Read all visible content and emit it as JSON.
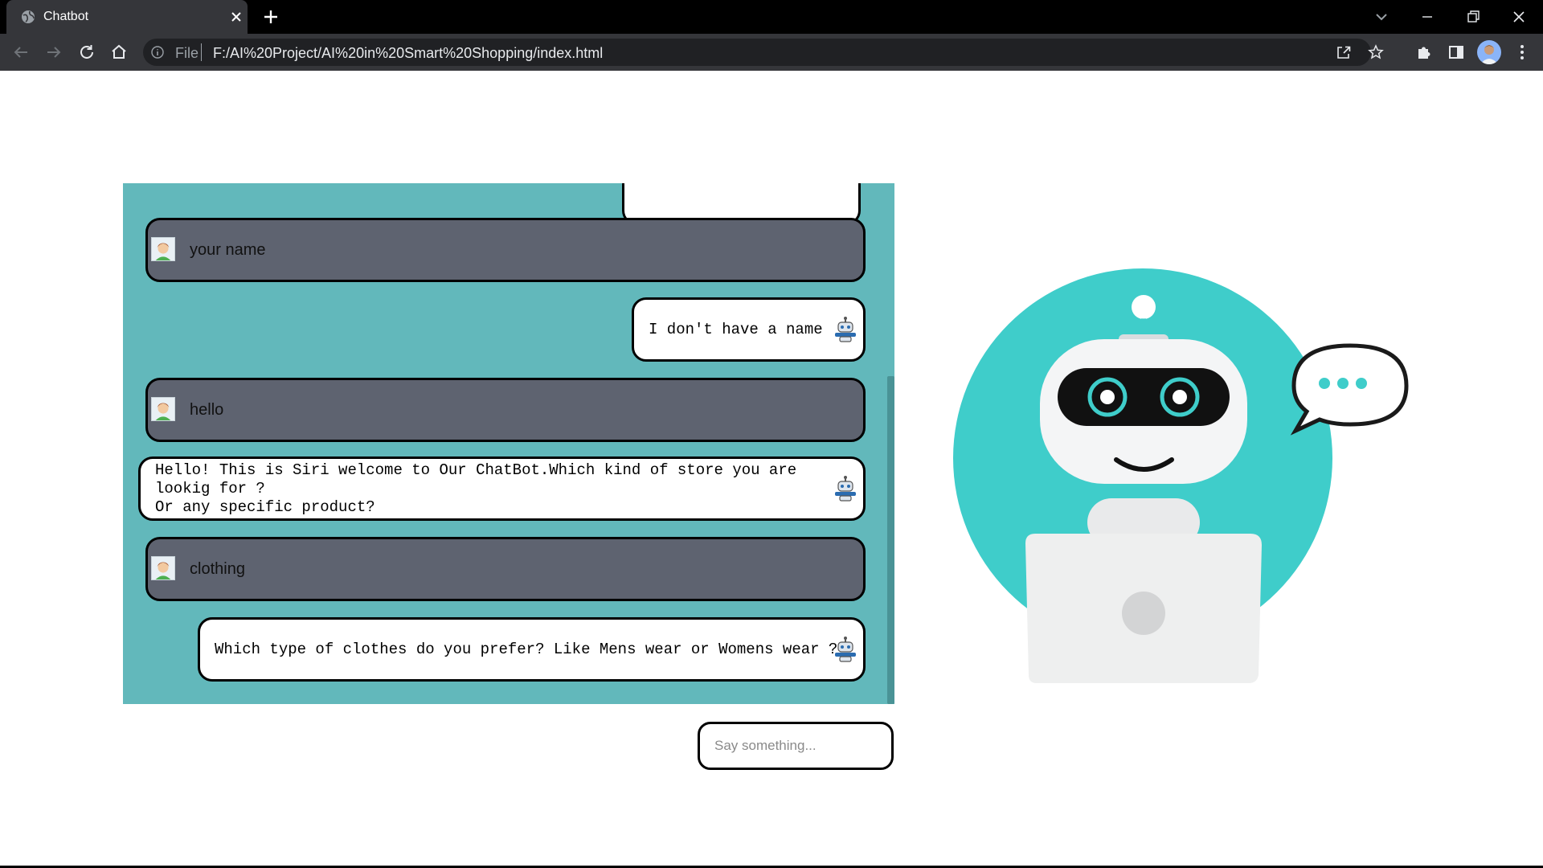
{
  "browser": {
    "tab_title": "Chatbot",
    "url_scheme": "File",
    "url": "F:/AI%20Project/AI%20in%20Smart%20Shopping/index.html"
  },
  "chat": {
    "messages": [
      {
        "sender": "user",
        "text": "your name"
      },
      {
        "sender": "bot",
        "text": "I don't have a name"
      },
      {
        "sender": "user",
        "text": "hello"
      },
      {
        "sender": "bot",
        "text": "Hello! This is Siri welcome to Our ChatBot.Which kind of store you are\nlookig for ?\nOr any specific product?"
      },
      {
        "sender": "user",
        "text": "clothing"
      },
      {
        "sender": "bot",
        "text": "Which type of clothes do you prefer? Like Mens wear or Womens wear ?"
      }
    ],
    "input_placeholder": "Say something...",
    "input_value": ""
  },
  "colors": {
    "panel_bg": "#62b8bb",
    "user_bubble": "#5e6370",
    "bot_bubble": "#ffffff",
    "robot_accent": "#3fcdca"
  },
  "icons": {
    "user_avatar": "user-avatar-icon",
    "bot_avatar": "robot-icon",
    "illustration": "robot-with-laptop"
  }
}
